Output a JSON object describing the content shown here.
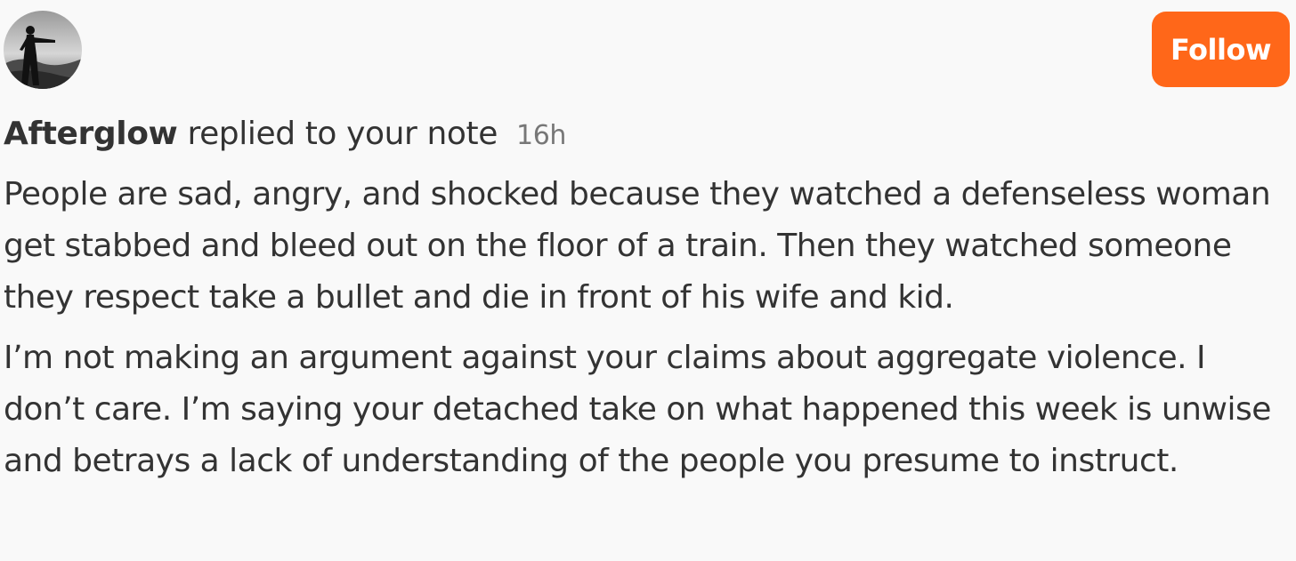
{
  "user": {
    "name": "Afterglow",
    "action": "replied to your note",
    "timestamp": "16h"
  },
  "follow_button": {
    "label": "Follow",
    "color": "#ff6719"
  },
  "reply": {
    "paragraphs": [
      "People are sad, angry, and shocked because they watched a defenseless woman get stabbed and bleed out on the floor of a train. Then they watched someone they respect take a bullet and die in front of his wife and kid.",
      "I’m not making an argument against your claims about aggregate violence. I don’t care. I’m saying your detached take on what happened this week is unwise and betrays a lack of understanding of the people you presume to instruct."
    ]
  }
}
